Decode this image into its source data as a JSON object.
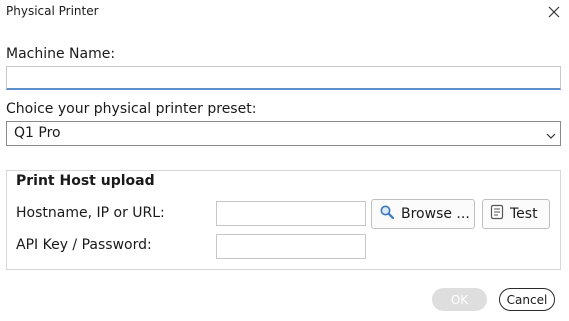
{
  "window": {
    "title": "Physical Printer",
    "close_icon": "close-icon"
  },
  "machine": {
    "label": "Machine Name:",
    "value": ""
  },
  "preset": {
    "label": "Choice your physical printer preset:",
    "selected": "Q1 Pro",
    "arrow_icon": "chevron-down-icon"
  },
  "host_upload": {
    "group_title": "Print Host upload",
    "hostname_label": "Hostname, IP or URL:",
    "hostname_value": "",
    "apikey_label": "API Key / Password:",
    "apikey_value": "",
    "browse_label": "Browse ...",
    "browse_icon": "magnifier-icon",
    "test_label": "Test",
    "test_icon": "document-icon"
  },
  "footer": {
    "ok_label": "OK",
    "ok_enabled": false,
    "cancel_label": "Cancel"
  },
  "colors": {
    "input_focus_underline": "#5e8fc8",
    "ok_disabled_bg": "#dedede",
    "icon_blue": "#3a78c2"
  }
}
